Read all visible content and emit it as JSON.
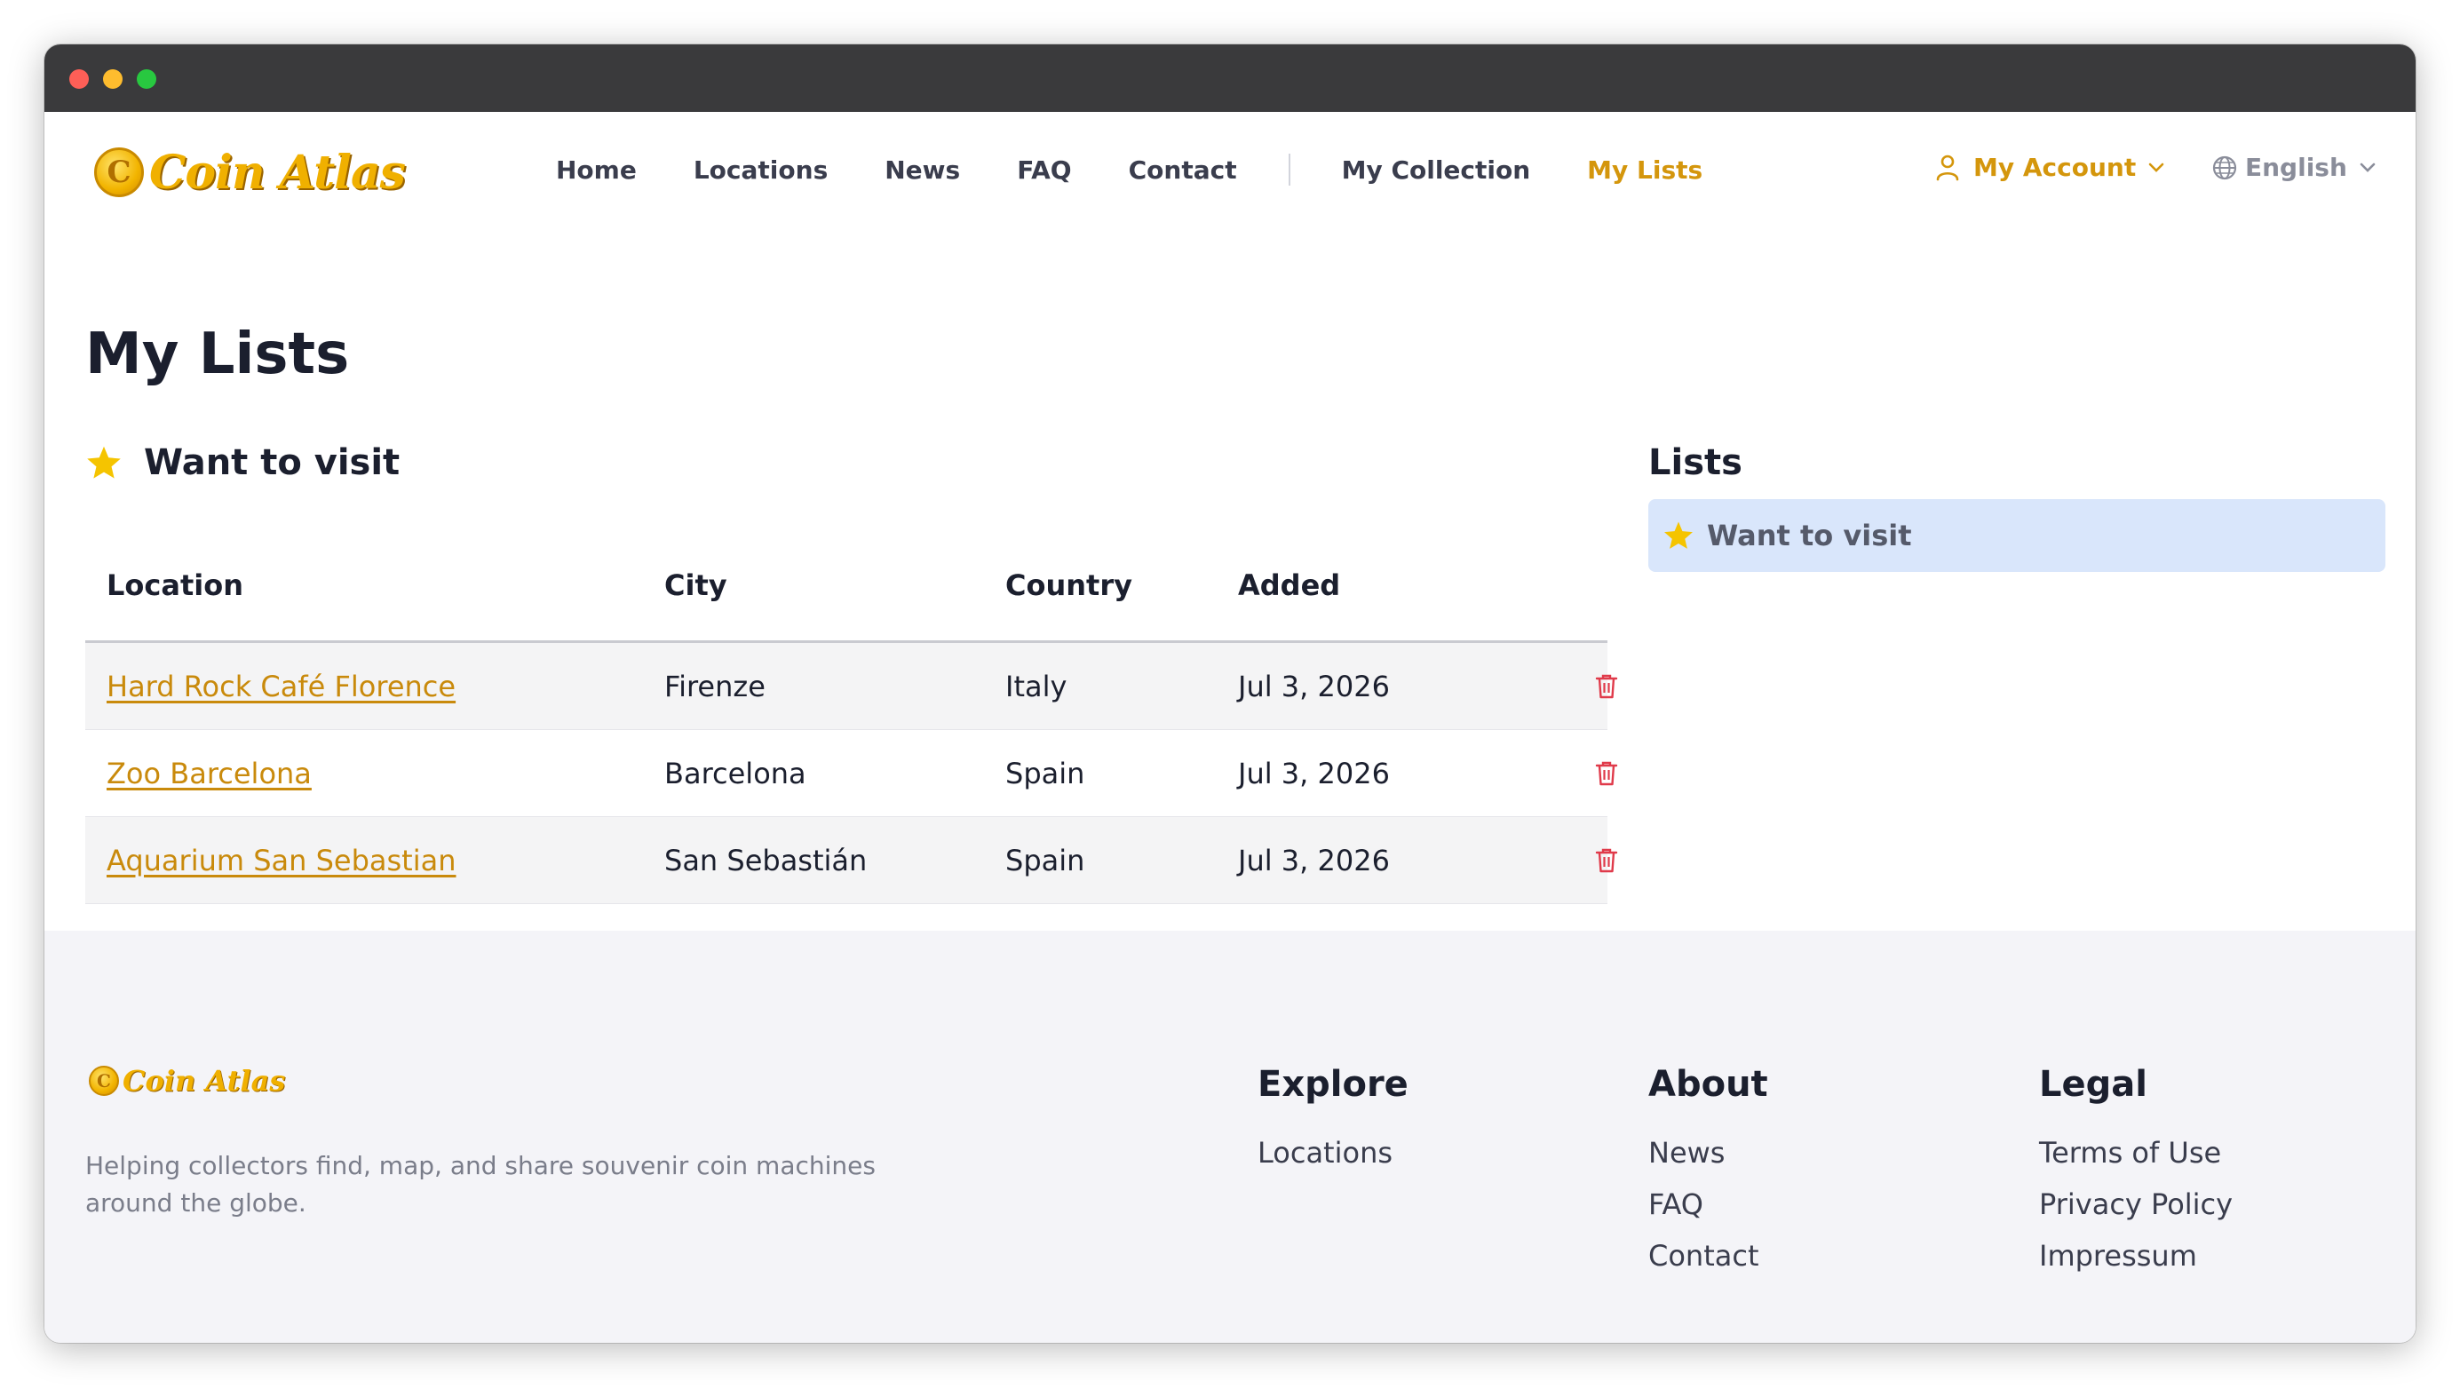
{
  "brand": {
    "name": "Coin Atlas",
    "coin_letter": "C"
  },
  "nav": {
    "links": [
      {
        "label": "Home"
      },
      {
        "label": "Locations"
      },
      {
        "label": "News"
      },
      {
        "label": "FAQ"
      },
      {
        "label": "Contact"
      }
    ],
    "user_links": [
      {
        "label": "My Collection"
      },
      {
        "label": "My Lists",
        "active": true
      }
    ],
    "account_label": "My Account",
    "language_label": "English"
  },
  "page": {
    "title": "My Lists",
    "list_heading": "Want to visit",
    "table": {
      "headers": [
        "Location",
        "City",
        "Country",
        "Added"
      ],
      "rows": [
        {
          "location": "Hard Rock Café Florence",
          "city": "Firenze",
          "country": "Italy",
          "added": "Jul 3, 2026"
        },
        {
          "location": "Zoo Barcelona",
          "city": "Barcelona",
          "country": "Spain",
          "added": "Jul 3, 2026"
        },
        {
          "location": "Aquarium San Sebastian",
          "city": "San Sebastián",
          "country": "Spain",
          "added": "Jul 3, 2026"
        }
      ]
    }
  },
  "sidebar": {
    "title": "Lists",
    "items": [
      {
        "label": "Want to visit",
        "selected": true
      }
    ]
  },
  "footer": {
    "tagline": "Helping collectors find, map, and share souvenir coin machines around the globe.",
    "columns": [
      {
        "title": "Explore",
        "links": [
          "Locations"
        ]
      },
      {
        "title": "About",
        "links": [
          "News",
          "FAQ",
          "Contact"
        ]
      },
      {
        "title": "Legal",
        "links": [
          "Terms of Use",
          "Privacy Policy",
          "Impressum"
        ]
      }
    ]
  },
  "colors": {
    "accent": "#d4960c",
    "link": "#c98a0c",
    "star": "#f5c400",
    "danger": "#e03a4a",
    "selected_bg": "#d9e6fb",
    "footer_bg": "#f4f4f8"
  },
  "icons": [
    "star-icon",
    "trash-icon",
    "user-icon",
    "globe-icon",
    "chevron-down-icon"
  ]
}
